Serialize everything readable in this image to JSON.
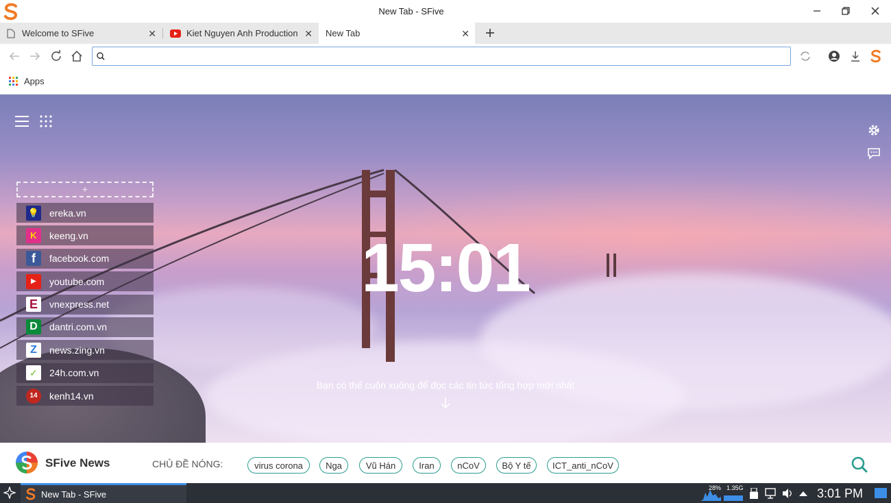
{
  "window": {
    "title": "New Tab - SFive"
  },
  "tabs": [
    {
      "label": "Welcome to SFive",
      "icon": "page-icon"
    },
    {
      "label": "Kiet Nguyen Anh Production",
      "icon": "youtube-icon"
    },
    {
      "label": "New Tab",
      "icon": ""
    }
  ],
  "omnibox": {
    "value": "",
    "placeholder": ""
  },
  "bookmarks": {
    "apps_label": "Apps"
  },
  "hero": {
    "clock": "15:01",
    "scroll_hint": "Bạn có thể cuộn xuống để đọc các tin tức tổng hợp mới nhất",
    "add_tile": "+"
  },
  "sites": [
    {
      "label": "ereka.vn",
      "fav": "💡",
      "color": "#1f2a8a"
    },
    {
      "label": "keeng.vn",
      "fav": "K",
      "color": "#e0308a"
    },
    {
      "label": "facebook.com",
      "fav": "f",
      "color": "#3b5998"
    },
    {
      "label": "youtube.com",
      "fav": "▶",
      "color": "#e62117"
    },
    {
      "label": "vnexpress.net",
      "fav": "E",
      "color": "#ffffff"
    },
    {
      "label": "dantri.com.vn",
      "fav": "D",
      "color": "#0a8a3a"
    },
    {
      "label": "news.zing.vn",
      "fav": "Z",
      "color": "#ffffff"
    },
    {
      "label": "24h.com.vn",
      "fav": "✓",
      "color": "#ffffff"
    },
    {
      "label": "kenh14.vn",
      "fav": "14",
      "color": "#c0271f"
    }
  ],
  "news": {
    "title": "SFive News",
    "hot_label": "CHỦ ĐỀ NÓNG:",
    "topics": [
      "virus corona",
      "Nga",
      "Vũ Hán",
      "Iran",
      "nCoV",
      "Bộ Y tế",
      "ICT_anti_nCoV"
    ]
  },
  "taskbar": {
    "task_label": "New Tab - SFive",
    "cpu": "28%",
    "mem": "1.35G",
    "time": "3:01 PM"
  },
  "colors": {
    "accent": "#2a9d8f",
    "taskbar": "#2b2f36"
  }
}
